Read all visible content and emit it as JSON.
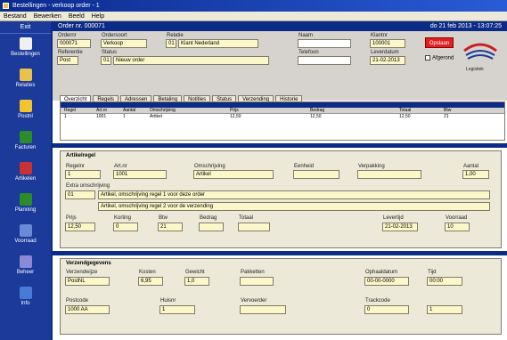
{
  "window": {
    "title": "Bestellingen - verkoop order - 1"
  },
  "menu": [
    "Bestand",
    "Bewerken",
    "Beeld",
    "Help"
  ],
  "sidebar": {
    "exit_label": "Exit",
    "items": [
      {
        "label": "Bestellingen",
        "icon": "orders-icon",
        "color": "#f0f0f0"
      },
      {
        "label": "Relaties",
        "icon": "relations-icon",
        "color": "#e8c24a"
      },
      {
        "label": "Postnl",
        "icon": "postnl-icon",
        "color": "#f4c430"
      },
      {
        "label": "Facturen",
        "icon": "invoices-icon",
        "color": "#2a8c2a"
      },
      {
        "label": "Artikelen",
        "icon": "articles-icon",
        "color": "#c83232"
      },
      {
        "label": "Planning",
        "icon": "planning-icon",
        "color": "#2a8c2a"
      },
      {
        "label": "Voorraad",
        "icon": "stock-icon",
        "color": "#6a8ad8"
      },
      {
        "label": "Beheer",
        "icon": "admin-icon",
        "color": "#8a8ad8"
      },
      {
        "label": "Info",
        "icon": "info-icon",
        "color": "#4a7ad8"
      }
    ]
  },
  "main": {
    "title": "Order nr. 000071",
    "date": "do 21 feb 2013 - 13:07:25"
  },
  "header": {
    "labels": [
      "Ordernr",
      "Ordersoort",
      "Relatie",
      "Naam",
      "Klantnr",
      "Referentie",
      "Status",
      "Telefoon",
      "Leverdatum"
    ],
    "ordernr": "000071",
    "ordersoort": "Verkoop",
    "relatie_code": "01",
    "relatie_naam": "Klant Nederland",
    "klantnr": "100001",
    "referentie": "Post",
    "status_code": "01",
    "status_text": "Nieuw order",
    "telefoon": "",
    "leverdatum": "21-02-2013",
    "button_label": "Opslaan",
    "checkbox_label": "Afgerond",
    "logo_text": "Logistiek"
  },
  "tabs": [
    "Overzicht",
    "Regels",
    "Adressen",
    "Betaling",
    "Notities",
    "Status",
    "Verzending",
    "Historie"
  ],
  "grid": {
    "columns": [
      "Regel",
      "Art.nr",
      "Aantal",
      "Omschrijving",
      "Prijs",
      "Bedrag",
      "Totaal",
      "Btw"
    ],
    "rows": [
      [
        "1",
        "1001",
        "1",
        "Artikel",
        "12,50",
        "12,50",
        "12,50",
        "21"
      ]
    ]
  },
  "artikel": {
    "title": "Artikelregel",
    "labels": [
      "Regelnr",
      "Art.nr",
      "Omschrijving",
      "Eenheid",
      "Verpakking",
      "Aantal"
    ],
    "regelnr": "1",
    "artnr": "1001",
    "omschrijving": "Artikel",
    "eenheid": "",
    "verpakking": "",
    "aantal": "1,00",
    "extra_label": "Extra omschrijving",
    "extra_code": "01",
    "extra_line1": "Artikel, omschrijving regel 1 voor deze order",
    "extra_line2": "Artikel, omschrijving regel 2 voor de verzending",
    "row3_labels": [
      "Prijs",
      "Korting",
      "Btw",
      "Bedrag",
      "Totaal",
      "Levertijd",
      "Voorraad"
    ],
    "prijs": "12,50",
    "korting": "0",
    "btw": "21",
    "bedrag": "",
    "totaal": "",
    "levertijd": "21-02-2013",
    "voorraad": "10"
  },
  "verzending": {
    "title": "Verzendgegevens",
    "labels": [
      "Verzendwijze",
      "Kosten",
      "Gewicht",
      "Pakketten",
      "Ophaaldatum",
      "Tijd",
      "Postcode",
      "Huisnr",
      "Vervoerder",
      "Trackcode"
    ],
    "verzendwijze": "PostNL",
    "kosten": "6,95",
    "gewicht": "1,0",
    "pakketten": "",
    "ophaaldatum": "00-00-0000",
    "tijd": "00:00",
    "postcode": "1000 AA",
    "huisnr": "1",
    "vervoerder": "",
    "trackcode": "0"
  }
}
